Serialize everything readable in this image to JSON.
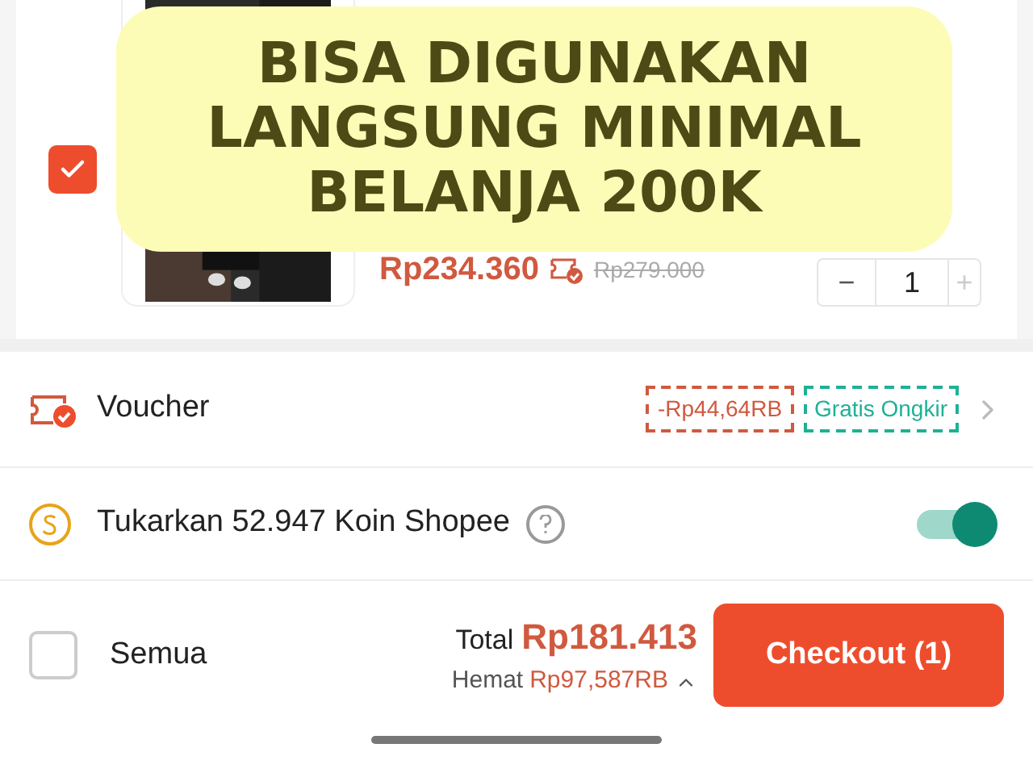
{
  "product": {
    "selected": true,
    "price": "Rp234.360",
    "original_price": "Rp279.000",
    "quantity": "1",
    "minus": "−",
    "plus": "+"
  },
  "banner": {
    "lines": [
      "BISA DIGUNAKAN",
      "LANGSUNG MINIMAL",
      "BELANJA 200K"
    ]
  },
  "voucher": {
    "label": "Voucher",
    "tags": [
      {
        "text": "-Rp44,64RB",
        "color": "#d0593f"
      },
      {
        "text": "Gratis Ongkir",
        "color": "#1eb196"
      }
    ]
  },
  "coins": {
    "label": "Tukarkan 52.947 Koin Shopee",
    "on": true
  },
  "footer": {
    "select_all": {
      "label": "Semua",
      "checked": false
    },
    "total_label": "Total",
    "total": "Rp181.413",
    "savings_label": "Hemat",
    "savings": "Rp97,587RB",
    "checkout": "Checkout (1)"
  }
}
